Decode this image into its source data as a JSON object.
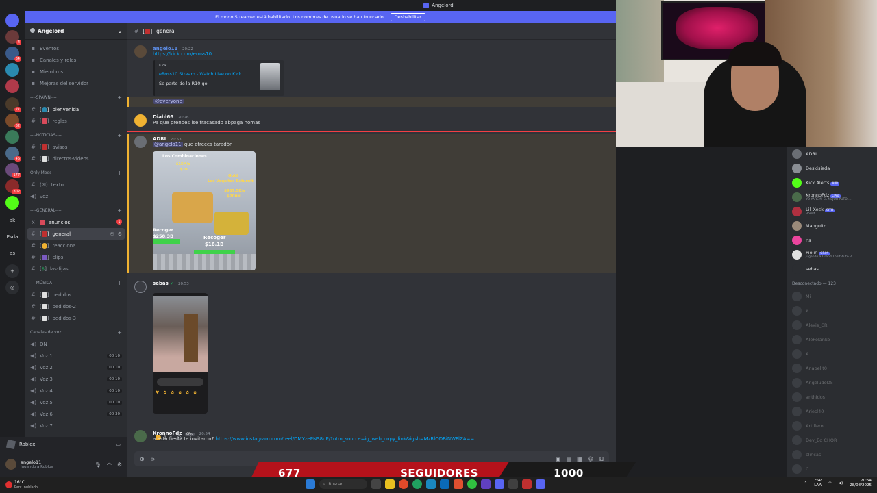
{
  "window": {
    "title": "Angelord"
  },
  "banner": {
    "text": "El modo Streamer está habilitado. Los nombres de usuario se han truncado.",
    "button": "Deshabilitar"
  },
  "server_rail": [
    {
      "label": "",
      "badge": "",
      "color": "#5865f2"
    },
    {
      "label": "",
      "badge": "4",
      "color": "#6b3a3a"
    },
    {
      "label": "",
      "badge": "64",
      "color": "#3a5a8a"
    },
    {
      "label": "",
      "badge": "",
      "color": "#2a8ab0"
    },
    {
      "label": "",
      "badge": "",
      "color": "#b03a4a"
    },
    {
      "label": "",
      "badge": "27",
      "color": "#4a3a2a"
    },
    {
      "label": "",
      "badge": "62",
      "color": "#7a4a2a"
    },
    {
      "label": "",
      "badge": "",
      "color": "#3a7a5a"
    },
    {
      "label": "",
      "badge": "46",
      "color": "#4a6a8a"
    },
    {
      "label": "",
      "badge": "177",
      "color": "#6a4a7a"
    },
    {
      "label": "",
      "badge": "302",
      "color": "#8a2a2a"
    },
    {
      "label": "",
      "badge": "",
      "color": "#53fc18"
    },
    {
      "label": "ak",
      "badge": "",
      "color": "transparent"
    },
    {
      "label": "Esda",
      "badge": "",
      "color": "transparent"
    },
    {
      "label": "as",
      "badge": "",
      "color": "transparent"
    },
    {
      "label": "+",
      "badge": "",
      "color": "#2b2d31"
    },
    {
      "label": "◎",
      "badge": "",
      "color": "#2b2d31"
    }
  ],
  "guild": {
    "name": "Angelord"
  },
  "nav_items": [
    {
      "label": "Eventos",
      "icon": "calendar-icon"
    },
    {
      "label": "Canales y roles",
      "icon": "list-icon"
    },
    {
      "label": "Miembros",
      "icon": "members-icon"
    },
    {
      "label": "Mejoras del servidor",
      "icon": "boost-icon"
    }
  ],
  "categories": {
    "spawn": "----SPAWN----",
    "noticias": "----NOTICIAS----",
    "only_mods": "Only Mods",
    "general": "----GENERAL----",
    "musica": "----MÚSICA----",
    "voz": "Canales de voz"
  },
  "channels": {
    "bienvenida": "bienvenida",
    "reglas": "reglas",
    "avisos": "avisos",
    "directos": "directos-videos",
    "texto": "texto",
    "voz": "voz",
    "anuncios": "anuncios",
    "anuncios_badge": "1",
    "general": "general",
    "reacciona": "reacciona",
    "clips": "clips",
    "las_fijas": "las-fijas",
    "pedidos": "pedidos",
    "pedidos2": "pedidos-2",
    "pedidos3": "pedidos-3"
  },
  "voice_channels": [
    {
      "label": "ON",
      "count": ""
    },
    {
      "label": "Voz 1",
      "count": "00 10"
    },
    {
      "label": "Voz 2",
      "count": "00 10"
    },
    {
      "label": "Voz 3",
      "count": "00 10"
    },
    {
      "label": "Voz 4",
      "count": "00 10"
    },
    {
      "label": "Voz 5",
      "count": "00 10"
    },
    {
      "label": "Voz 6",
      "count": "00 30"
    },
    {
      "label": "Voz 7",
      "count": ""
    }
  ],
  "voice_status": {
    "label": "Roblox"
  },
  "user": {
    "name": "angelo11",
    "status": "Jugando a Roblox"
  },
  "chat": {
    "channel": "general",
    "messages": {
      "m1": {
        "author": "angelo11",
        "time": "20:22",
        "link": "https://kick.com/eross10",
        "embed": {
          "provider": "Kick",
          "title": "eRoss10 Stream - Watch Live on Kick",
          "desc": "Se parte de la R10 go"
        }
      },
      "m1b": {
        "text": "@everyone"
      },
      "m2": {
        "author": "Diabl66",
        "time": "20:26",
        "text": "Pa que prendes ise fracasado abpaga nomas"
      },
      "m3": {
        "author": "ADRI",
        "time": "20:53",
        "mention": "@angelo11",
        "text": "que ofreces taradón",
        "image_text": {
          "top": "Los Combinaciones",
          "gold": "Gold",
          "vaquitas": "Las Vaquitas Saturnit",
          "rate": "$937.5K/s",
          "price": "$200M",
          "c1": "Recoger",
          "c1v": "$258.3B",
          "c2": "Recoger",
          "c2v": "$16.1B",
          "left_rate": "$15M/s",
          "left_price": "$2B"
        }
      },
      "m4": {
        "author": "sebas",
        "time": "20:53",
        "reaction_count": "1"
      },
      "m5": {
        "author": "KronnoFdz",
        "tag": "CPro",
        "time": "20:54",
        "text": "a esta fiesta te invitaron?",
        "link": "https://www.instagram.com/reel/DMYzePNS8uP/?utm_source=ig_web_copy_link&igsh=MzRlODBiNWFlZA=="
      }
    },
    "input_placeholder": ""
  },
  "members": {
    "online": [
      {
        "name": "ADRI",
        "tag": "",
        "sub": "",
        "color": "#dbdee1"
      },
      {
        "name": "Deskisiada",
        "tag": "",
        "sub": "",
        "color": "#dbdee1"
      },
      {
        "name": "Kick Alerts",
        "tag": "APP",
        "sub": "",
        "color": "#dbdee1"
      },
      {
        "name": "KronnoFdz",
        "tag": "CPro",
        "sub": "YO YAREMI EL MEJOR PUTO ...",
        "color": "#dbdee1"
      },
      {
        "name": "Lil_Xeck",
        "tag": "SITH",
        "sub": "Borolt",
        "color": "#dbdee1"
      },
      {
        "name": "Manguito",
        "tag": "",
        "sub": "",
        "color": "#dbdee1"
      },
      {
        "name": "ns",
        "tag": "",
        "sub": "",
        "color": "#dbdee1"
      },
      {
        "name": "Piolin",
        "tag": "CRIM",
        "sub": "Jugando a Grand Theft Auto V...",
        "color": "#dbdee1"
      },
      {
        "name": "sebas",
        "tag": "",
        "sub": "",
        "color": "#dbdee1"
      }
    ],
    "offline_header": "Desconectado — 123",
    "offline": [
      "Mi",
      "k",
      "Alexis_CR",
      "AlePolanko",
      "A...",
      "Anabelit0",
      "AngeludoD5",
      "anthidos",
      "Ariesl40",
      "Artillero",
      "Dev_Ed CHOR",
      "clincas",
      "C..."
    ]
  },
  "overlay": {
    "left": "677",
    "mid": "SEGUIDORES",
    "right": "1000"
  },
  "taskbar": {
    "weather": "16°C",
    "weather_sub": "Parc. nublado",
    "search": "Buscar",
    "lang": "ESP",
    "lang2": "LAA",
    "time": "20:54",
    "date": "28/08/2025"
  }
}
